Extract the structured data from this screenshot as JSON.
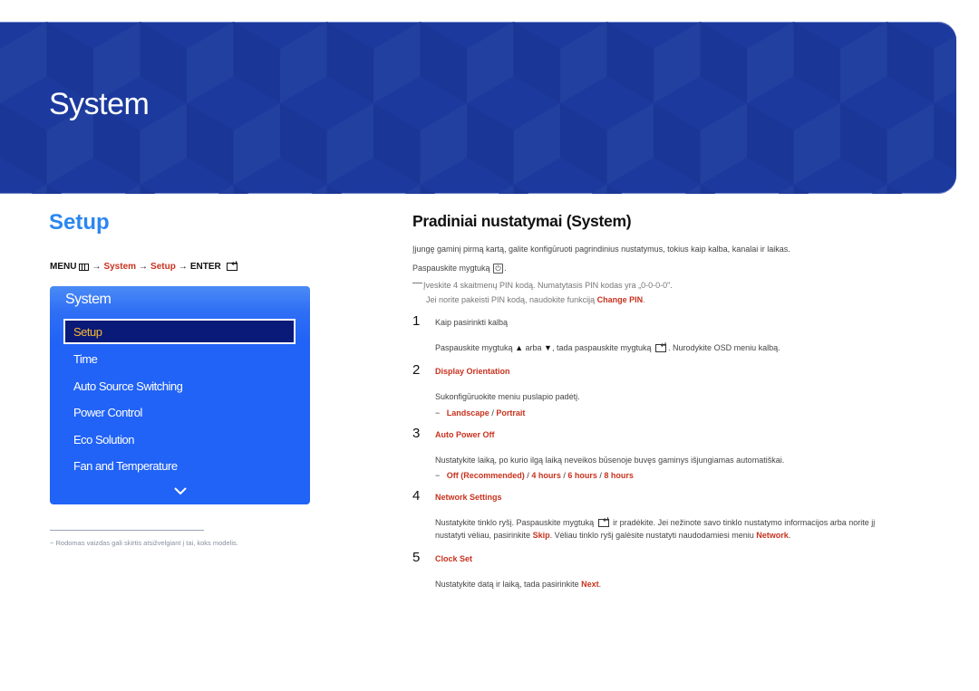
{
  "banner": {
    "title": "System",
    "color": "#1c3a9e"
  },
  "section_title": "Setup",
  "breadcrumb": {
    "menu": "MENU",
    "menu_icon": "menu-grid-icon",
    "arrow": "→",
    "system": "System",
    "setup": "Setup",
    "enter": "ENTER",
    "enter_icon": "enter-icon"
  },
  "osd_menu": {
    "title": "System",
    "selected": "Setup",
    "items": [
      "Setup",
      "Time",
      "Auto Source Switching",
      "Power Control",
      "Eco Solution",
      "Fan and Temperature"
    ],
    "more_icon": "chevron-down-icon",
    "colors": {
      "panel": "#2163f6",
      "selected_bg": "#0a1a78",
      "selected_text": "#f7b733"
    }
  },
  "footnote": {
    "dash": "−",
    "text": "Rodomas vaizdas gali skirtis atsižvelgiant į tai, koks modelis."
  },
  "content": {
    "heading": "Pradiniai nustatymai (System)",
    "intro": "Įjungę gaminį pirmą kartą, galite konfigūruoti pagrindinius nustatymus, tokius kaip kalba, kanalai ir laikas.",
    "press_button": "Paspauskite mygtuką",
    "press_button_icon": "power-icon",
    "note_line1": "Įveskite 4 skaitmenų PIN kodą. Numatytasis PIN kodas yra „0-0-0-0\".",
    "note_line2_pre": "Jei norite pakeisti PIN kodą, naudokite funkciją",
    "note_line2_link": "Change PIN",
    "steps": [
      {
        "number": "1",
        "title": "Kaip pasirinkti kalbą",
        "desc_pre": "Paspauskite mygtuką",
        "up": "▲",
        "or": "arba",
        "down": "▼",
        "desc_mid": ", tada paspauskite mygtuką",
        "desc_post": ". Nurodykite OSD meniu kalbą."
      },
      {
        "number": "2",
        "title": "Display Orientation",
        "desc": "Sukonfigūruokite meniu puslapio padėtį.",
        "options": [
          "Landscape",
          "Portrait"
        ]
      },
      {
        "number": "3",
        "title": "Auto Power Off",
        "desc": "Nustatykite laiką, po kurio ilgą laiką neveikos būsenoje buvęs gaminys išjungiamas automatiškai.",
        "options": [
          "Off (Recommended)",
          "4 hours",
          "6 hours",
          "8 hours"
        ]
      },
      {
        "number": "4",
        "title": "Network Settings",
        "line1_pre": "Nustatykite tinklo ryšį. Paspauskite mygtuką",
        "line1_post": "ir pradėkite. Jei nežinote savo tinklo nustatymo informacijos arba norite jį",
        "line2_pre": "nustatyti vėliau, pasirinkite",
        "line2_skip": "Skip",
        "line2_mid": ". Vėliau tinklo ryšį galėsite nustatyti naudodamiesi meniu",
        "line2_network": "Network",
        "line2_post": "."
      },
      {
        "number": "5",
        "title": "Clock Set",
        "desc_pre": "Nustatykite datą ir laiką, tada pasirinkite",
        "desc_link": "Next",
        "desc_post": "."
      }
    ],
    "option_dash": "−",
    "separator": " / ",
    "accent_color": "#c8321e"
  }
}
